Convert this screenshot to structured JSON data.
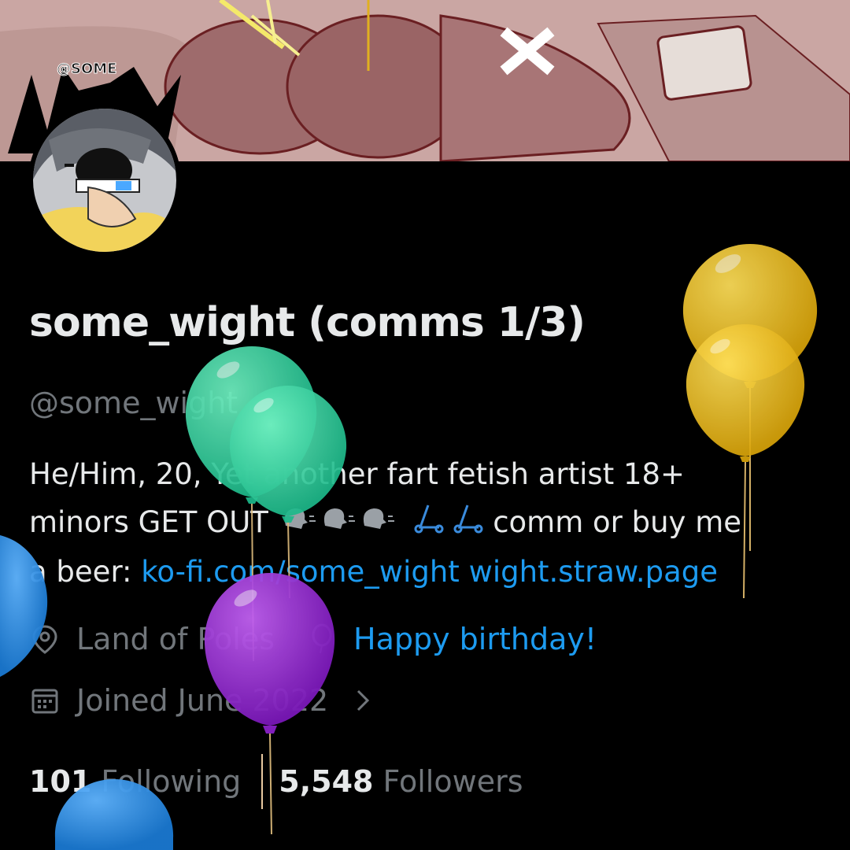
{
  "banner": {
    "logo_text": "@SOME"
  },
  "profile": {
    "display_name": "some_wight (comms 1/3)",
    "handle": "@some_wight",
    "bio": {
      "line1": "He/Him, 20, Yet another fart fetish artist 18+",
      "line2_prefix": "minors GET OUT",
      "line2_suffix": "comm or buy me",
      "line3_prefix": "a beer: ",
      "link1": "ko-fi.com/some_wight",
      "link2": "wight.straw.page"
    },
    "location": "Land of Poles",
    "birthday": "Happy birthday!",
    "joined": "Joined June 2022",
    "following_count": "101",
    "following_label": "Following",
    "followers_count": "5,548",
    "followers_label": "Followers"
  },
  "icons": {
    "location": "location-pin-icon",
    "birthday": "balloon-icon",
    "joined": "calendar-icon",
    "chevron": "chevron-right-icon"
  },
  "colors": {
    "background": "#000000",
    "text_primary": "#e7e9ea",
    "text_secondary": "#71767b",
    "link": "#1d9bf0",
    "balloon_green": "#2fd19a",
    "balloon_yellow": "#e8b814",
    "balloon_purple": "#9b2fd6",
    "balloon_blue": "#2d8fe0"
  }
}
